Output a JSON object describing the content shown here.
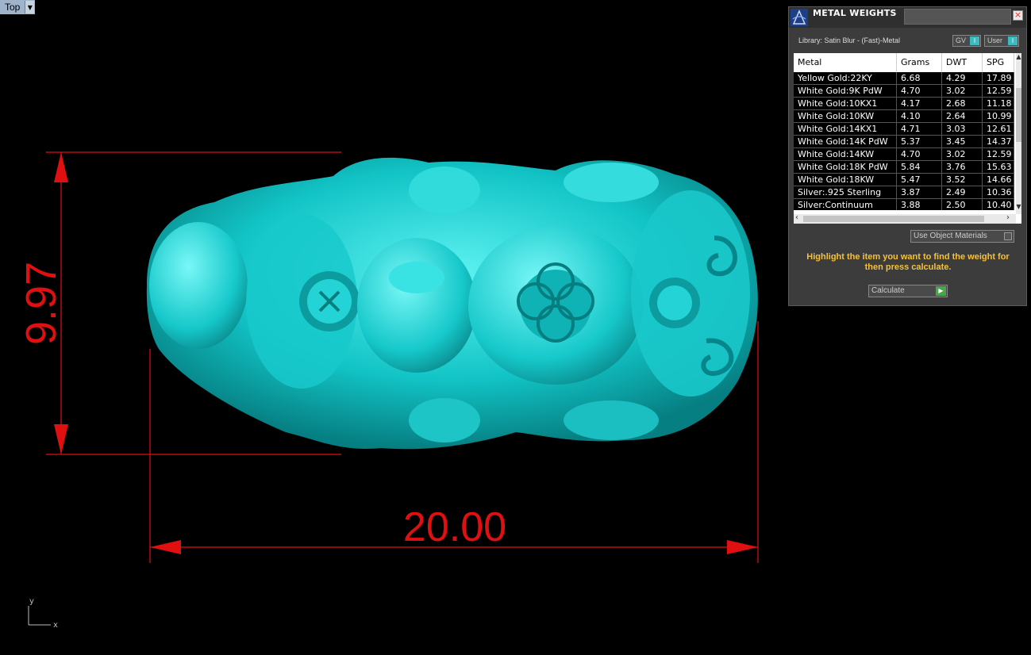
{
  "viewport": {
    "label": "Top"
  },
  "dimensions": {
    "width": "20.00",
    "height": "9.97"
  },
  "axes": {
    "x": "x",
    "y": "y"
  },
  "panel": {
    "title": "METAL WEIGHTS",
    "library": "Library: Satin Blur - (Fast)-Metal",
    "toggle_gv": "GV",
    "toggle_user": "User",
    "columns": [
      "Metal",
      "Grams",
      "DWT",
      "SPG"
    ],
    "rows": [
      [
        "Yellow Gold:22KY",
        "6.68",
        "4.29",
        "17.89"
      ],
      [
        "White Gold:9K PdW",
        "4.70",
        "3.02",
        "12.59"
      ],
      [
        "White Gold:10KX1",
        "4.17",
        "2.68",
        "11.18"
      ],
      [
        "White Gold:10KW",
        "4.10",
        "2.64",
        "10.99"
      ],
      [
        "White Gold:14KX1",
        "4.71",
        "3.03",
        "12.61"
      ],
      [
        "White Gold:14K PdW",
        "5.37",
        "3.45",
        "14.37"
      ],
      [
        "White Gold:14KW",
        "4.70",
        "3.02",
        "12.59"
      ],
      [
        "White Gold:18K PdW",
        "5.84",
        "3.76",
        "15.63"
      ],
      [
        "White Gold:18KW",
        "5.47",
        "3.52",
        "14.66"
      ],
      [
        "Silver:.925 Sterling",
        "3.87",
        "2.49",
        "10.36"
      ],
      [
        "Silver:Continuum",
        "3.88",
        "2.50",
        "10.40"
      ]
    ],
    "use_object_materials": "Use Object Materials",
    "hint": "Highlight the item you want to find the weight for then press calculate.",
    "calculate": "Calculate"
  },
  "colors": {
    "model": "#1fd6d6",
    "dimension": "#e01010",
    "hint": "#f6c13a"
  }
}
